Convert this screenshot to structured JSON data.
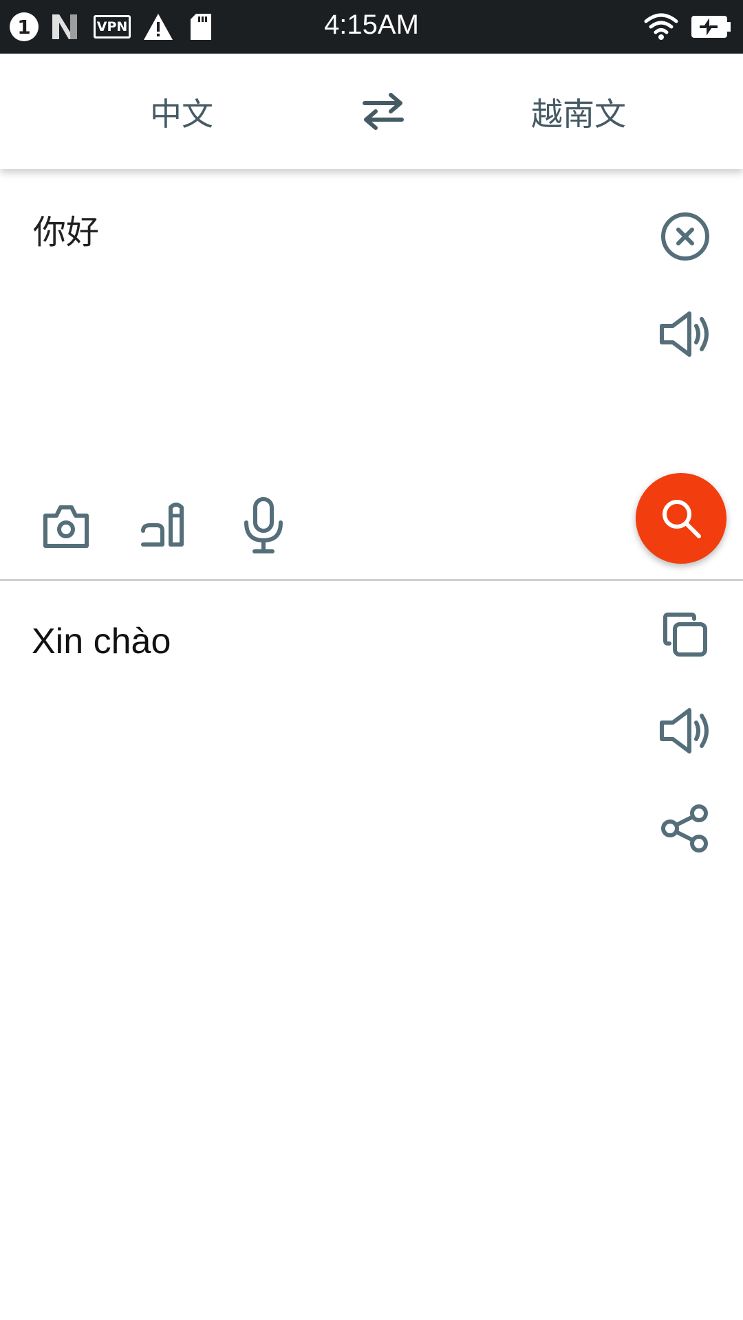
{
  "status_bar": {
    "notification_count": "1",
    "vpn_label": "VPN",
    "time": "4:15AM",
    "icons": [
      "notification-count-icon",
      "n-app-icon",
      "vpn-icon",
      "warning-icon",
      "sd-card-icon",
      "wifi-icon",
      "battery-charging-icon"
    ],
    "background": "#1b1f22"
  },
  "header": {
    "source_language": "中文",
    "target_language": "越南文",
    "swap_icon": "swap-arrows-icon"
  },
  "input": {
    "text": "你好",
    "actions": [
      "clear-icon",
      "speaker-icon"
    ],
    "tools": [
      "camera-icon",
      "handwriting-icon",
      "microphone-icon"
    ],
    "search_icon": "search-icon",
    "accent_color": "#f23d0e"
  },
  "output": {
    "text": "Xin chào",
    "actions": [
      "copy-icon",
      "speaker-icon",
      "share-icon"
    ]
  },
  "colors": {
    "icon": "#546e7a",
    "text": "#212121"
  }
}
